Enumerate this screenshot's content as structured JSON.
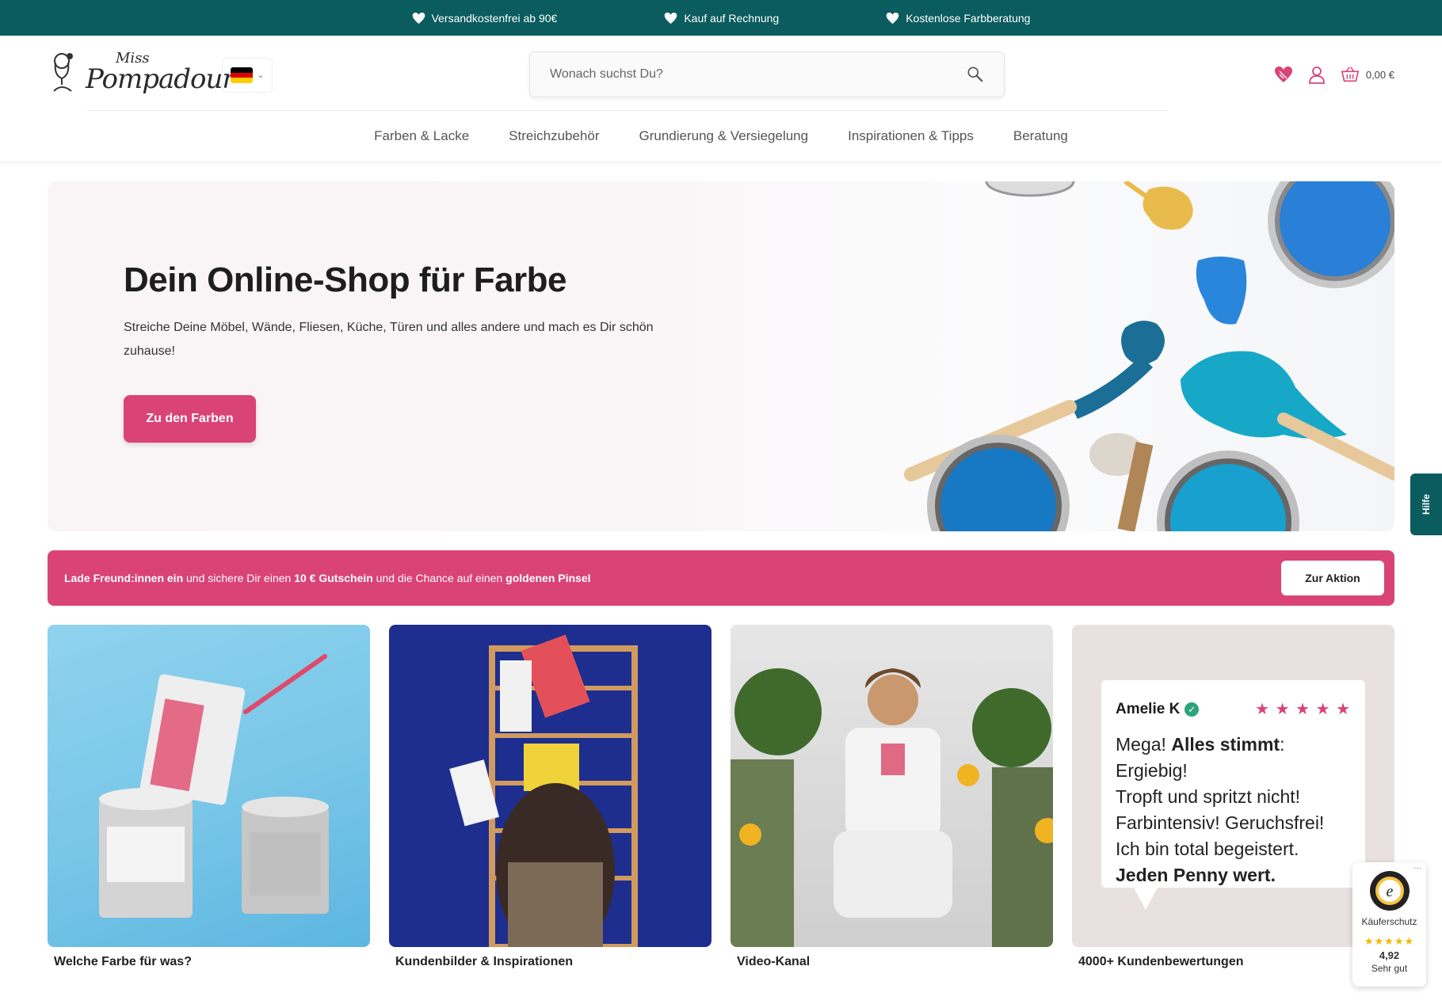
{
  "topbar": {
    "usps": [
      "Versandkostenfrei ab 90€",
      "Kauf auf Rechnung",
      "Kostenlose Farbberatung"
    ]
  },
  "header": {
    "logo_line1": "Miss",
    "logo_line2": "Pompadour",
    "search_placeholder": "Wonach suchst Du?",
    "cart_total": "0,00 €"
  },
  "nav": {
    "items": [
      "Farben & Lacke",
      "Streichzubehör",
      "Grundierung & Versiegelung",
      "Inspirationen & Tipps",
      "Beratung"
    ]
  },
  "hero": {
    "title": "Dein Online-Shop für Farbe",
    "text": "Streiche Deine Möbel, Wände, Fliesen, Küche, Türen und alles andere und mach es Dir schön zuhause!",
    "cta": "Zu den Farben"
  },
  "help": {
    "label": "Hilfe"
  },
  "promo": {
    "part1": "Lade Freund:innen ein",
    "part2": " und sichere Dir einen ",
    "part3": "10 € Gutschein",
    "part4": " und die Chance auf einen ",
    "part5": "goldenen Pinsel",
    "button": "Zur Aktion"
  },
  "tiles": [
    {
      "caption": "Welche Farbe für was?"
    },
    {
      "caption": "Kundenbilder & Inspirationen"
    },
    {
      "caption": "Video-Kanal"
    },
    {
      "caption": "4000+ Kundenbewertungen"
    }
  ],
  "review": {
    "name": "Amelie K",
    "stars": "★ ★ ★ ★ ★",
    "line1a": "Mega! ",
    "line1b": "Alles stimmt",
    "line1c": ": Ergiebig!",
    "line2": "Tropft und spritzt nicht!",
    "line3": "Farbintensiv! Geruchsfrei!",
    "line4": "Ich bin total begeistert.",
    "line5": "Jeden Penny wert."
  },
  "trusted": {
    "label": "Käuferschutz",
    "stars": "★★★★★",
    "score": "4,92",
    "rating": "Sehr gut"
  },
  "colors": {
    "teal": "#0b5c5e",
    "pink": "#da4375"
  }
}
